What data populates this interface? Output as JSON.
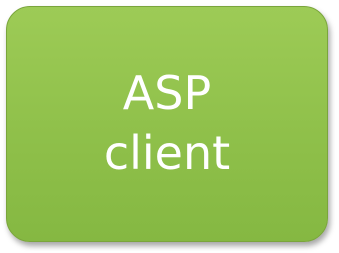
{
  "node": {
    "line1": "ASP",
    "line2": "client",
    "fill_color": "#8fc04a",
    "text_color": "#ffffff"
  }
}
